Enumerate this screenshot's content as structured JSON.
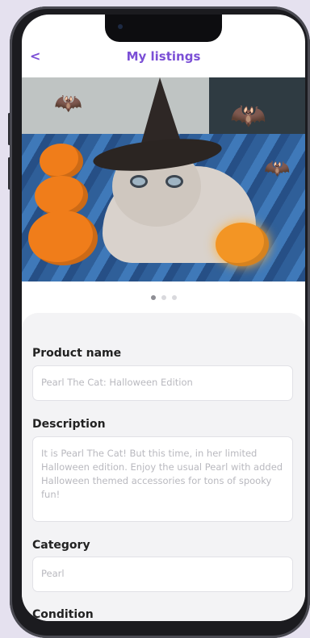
{
  "header": {
    "back_label": "<",
    "title": "My listings"
  },
  "carousel": {
    "total": 3,
    "active_index": 0
  },
  "form": {
    "product_name": {
      "label": "Product name",
      "value": "Pearl The Cat: Halloween Edition"
    },
    "description": {
      "label": "Description",
      "value": "It is Pearl The Cat! But this time, in her limited Halloween edition. Enjoy the usual Pearl with added Halloween themed accessories for tons of spooky fun!"
    },
    "category": {
      "label": "Category",
      "value": "Pearl"
    },
    "condition": {
      "label": "Condition"
    }
  }
}
